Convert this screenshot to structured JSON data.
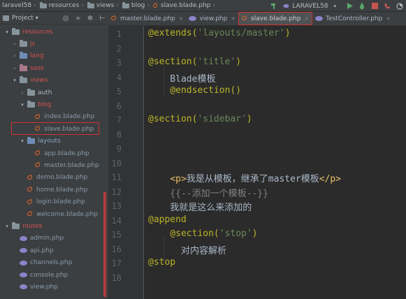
{
  "navbar": {
    "crumbs": [
      "laravel58",
      "resources",
      "views",
      "blog",
      "slave.blade.php"
    ],
    "run_config": "LARAVEL58"
  },
  "project_panel": {
    "title": "Project",
    "title_arrow": "▾",
    "tree": [
      {
        "label": "resources",
        "indent": 0,
        "arrow": "▾",
        "icon": "folder-gray",
        "color": "red"
      },
      {
        "label": "js",
        "indent": 1,
        "arrow": "›",
        "icon": "folder-gray",
        "color": "red"
      },
      {
        "label": "lang",
        "indent": 1,
        "arrow": "›",
        "icon": "folder-blue",
        "color": "red"
      },
      {
        "label": "sass",
        "indent": 1,
        "arrow": "›",
        "icon": "folder-pink",
        "color": "red"
      },
      {
        "label": "views",
        "indent": 1,
        "arrow": "▾",
        "icon": "folder-gray",
        "color": "red"
      },
      {
        "label": "auth",
        "indent": 2,
        "arrow": "›",
        "icon": "folder-gray",
        "color": "norm"
      },
      {
        "label": "blog",
        "indent": 2,
        "arrow": "▾",
        "icon": "folder-gray",
        "color": "red"
      },
      {
        "label": "index.blade.php",
        "indent": 3,
        "arrow": "",
        "icon": "blade",
        "color": "dim"
      },
      {
        "label": "slave.blade.php",
        "indent": 3,
        "arrow": "",
        "icon": "blade",
        "color": "dim"
      },
      {
        "label": "layouts",
        "indent": 2,
        "arrow": "▾",
        "icon": "folder-blue",
        "color": "blue"
      },
      {
        "label": "app.blade.php",
        "indent": 3,
        "arrow": "",
        "icon": "blade",
        "color": "dim"
      },
      {
        "label": "master.blade.php",
        "indent": 3,
        "arrow": "",
        "icon": "blade",
        "color": "dim"
      },
      {
        "label": "demo.blade.php",
        "indent": 2,
        "arrow": "",
        "icon": "blade",
        "color": "dim"
      },
      {
        "label": "home.blade.php",
        "indent": 2,
        "arrow": "",
        "icon": "blade",
        "color": "dim"
      },
      {
        "label": "login.blade.php",
        "indent": 2,
        "arrow": "",
        "icon": "blade",
        "color": "dim"
      },
      {
        "label": "welcome.blade.php",
        "indent": 2,
        "arrow": "",
        "icon": "blade",
        "color": "dim"
      },
      {
        "label": "routes",
        "indent": 0,
        "arrow": "▾",
        "icon": "folder-gray",
        "color": "red"
      },
      {
        "label": "admin.php",
        "indent": 1,
        "arrow": "",
        "icon": "php",
        "color": "dim"
      },
      {
        "label": "api.php",
        "indent": 1,
        "arrow": "",
        "icon": "php",
        "color": "dim"
      },
      {
        "label": "channels.php",
        "indent": 1,
        "arrow": "",
        "icon": "php",
        "color": "dim"
      },
      {
        "label": "console.php",
        "indent": 1,
        "arrow": "",
        "icon": "php",
        "color": "dim"
      },
      {
        "label": "view.php",
        "indent": 1,
        "arrow": "",
        "icon": "php",
        "color": "dim"
      }
    ]
  },
  "tabs": [
    {
      "label": "master.blade.php",
      "icon": "blade",
      "active": false
    },
    {
      "label": "view.php",
      "icon": "php",
      "active": false
    },
    {
      "label": "slave.blade.php",
      "icon": "blade",
      "active": true
    },
    {
      "label": "TestController.php",
      "icon": "php",
      "active": false
    }
  ],
  "tab_close": "×",
  "editor": {
    "line_numbers": [
      "1",
      "2",
      "3",
      "4",
      "5",
      "6",
      "7",
      "8",
      "9",
      "10",
      "11",
      "12",
      "13",
      "14",
      "15",
      "16",
      "17",
      "18"
    ],
    "lines": [
      {
        "line": 1,
        "tokens": [
          {
            "t": "@extends(",
            "c": "dir"
          },
          {
            "t": "'layouts/master'",
            "c": "str"
          },
          {
            "t": ")",
            "c": "dir"
          }
        ]
      },
      {
        "line": 3,
        "tokens": [
          {
            "t": "@section(",
            "c": "dir"
          },
          {
            "t": "'title'",
            "c": "str"
          },
          {
            "t": ")",
            "c": "dir"
          }
        ]
      },
      {
        "line": 4,
        "tokens": [
          {
            "t": "    Blade模板",
            "c": "plain"
          }
        ]
      },
      {
        "line": 5,
        "tokens": [
          {
            "t": "    @endsection()",
            "c": "dir"
          }
        ]
      },
      {
        "line": 7,
        "tokens": [
          {
            "t": "@section(",
            "c": "dir"
          },
          {
            "t": "'sidebar'",
            "c": "str"
          },
          {
            "t": ")",
            "c": "dir"
          }
        ]
      },
      {
        "line": 11,
        "tokens": [
          {
            "t": "    ",
            "c": "plain"
          },
          {
            "t": "<p>",
            "c": "tag"
          },
          {
            "t": "我是从模板，继承了master模板",
            "c": "plain"
          },
          {
            "t": "</p>",
            "c": "tag"
          }
        ]
      },
      {
        "line": 12,
        "tokens": [
          {
            "t": "    {{--添加一个模板--}}",
            "c": "cmt"
          }
        ]
      },
      {
        "line": 13,
        "tokens": [
          {
            "t": "    我就是这么来添加的",
            "c": "plain"
          }
        ]
      },
      {
        "line": 14,
        "tokens": [
          {
            "t": "@append",
            "c": "dir"
          }
        ]
      },
      {
        "line": 15,
        "tokens": [
          {
            "t": "    @section(",
            "c": "dir"
          },
          {
            "t": "'stop'",
            "c": "str"
          },
          {
            "t": ")",
            "c": "dir"
          }
        ]
      },
      {
        "line": 16,
        "tokens": [
          {
            "t": "      对内容解析",
            "c": "plain"
          }
        ]
      },
      {
        "line": 17,
        "tokens": [
          {
            "t": "@stop",
            "c": "dir"
          }
        ]
      }
    ]
  }
}
